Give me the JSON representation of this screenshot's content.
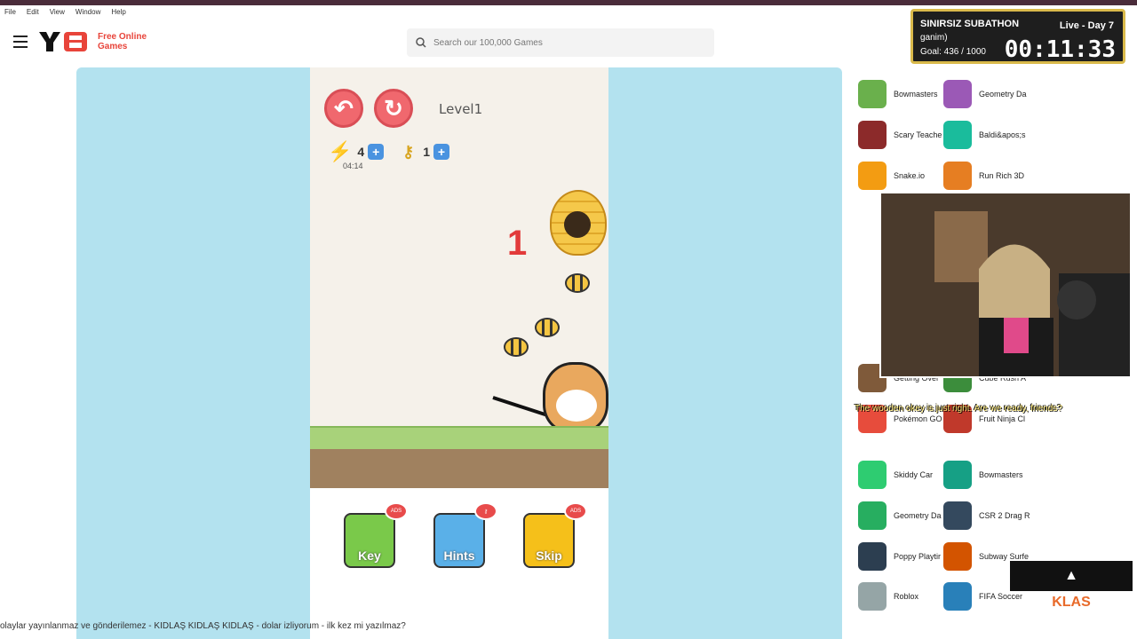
{
  "menubar": {
    "items": [
      "File",
      "Edit",
      "View",
      "Window",
      "Help"
    ]
  },
  "header": {
    "logo_text": "Y8",
    "tagline": "Free Online Games",
    "search_placeholder": "Search our 100,000 Games"
  },
  "game": {
    "level_label": "Level1",
    "energy_count": "4",
    "key_count": "1",
    "timer": "04:14",
    "bee_counter": "1",
    "ads_badge": "ADS",
    "buttons": {
      "key": "Key",
      "hints": "Hints",
      "skip": "Skip"
    }
  },
  "overlay": {
    "title": "SINIRSIZ SUBATHON",
    "day": "Live - Day 7",
    "user": "ganim)",
    "goal": "Goal: 436 / 1000",
    "clock": "00:11:33"
  },
  "sidebar": {
    "games_left": [
      "Bowmasters",
      "Scary Teache",
      "Snake.io",
      "Pokémon GO",
      "Skiddy Car",
      "Geometry Da",
      "Poppy Playtir",
      "Roblox"
    ],
    "games_right": [
      "Geometry Da",
      "Baldi&apos;s",
      "Run Rich 3D",
      "Fruit Ninja Cl",
      "Bowmasters",
      "CSR 2 Drag R",
      "Subway Surfe",
      "FIFA Soccer"
    ],
    "partial_left": "Getting Over",
    "partial_right": "Cube Rush A",
    "colors": {
      "icons_left": [
        "#6ab04c",
        "#8c2a2a",
        "#f39c12",
        "#e74c3c",
        "#2ecc71",
        "#27ae60",
        "#2c3e50",
        "#95a5a6"
      ],
      "icons_right": [
        "#9b59b6",
        "#1abc9c",
        "#e67e22",
        "#c0392b",
        "#16a085",
        "#34495e",
        "#d35400",
        "#2980b9"
      ]
    }
  },
  "stream": {
    "caption": "The wooden okey is just right. Are we ready, friends?",
    "ticker": "olaylar yayınlanmaz ve gönderilemez - KIDLAŞ KIDLAŞ KIDLAŞ - dolar izliyorum - ilk kez mi yazılmaz?",
    "klas_label": "KLAS"
  }
}
